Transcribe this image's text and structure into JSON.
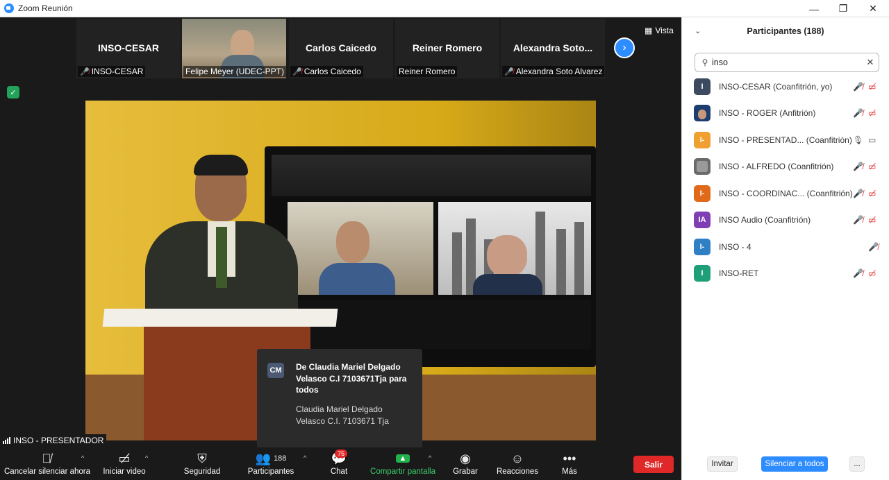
{
  "window": {
    "title": "Zoom Reunión",
    "controls": [
      "—",
      "❐",
      "✕"
    ]
  },
  "strip": {
    "tiles": [
      {
        "name": "INSO-CESAR",
        "label": "INSO-CESAR",
        "muted": true
      },
      {
        "name": "",
        "label": "Felipe Meyer (UDEC-PPT)",
        "muted": false,
        "photo": true
      },
      {
        "name": "Carlos Caicedo",
        "label": "Carlos Caicedo",
        "muted": true
      },
      {
        "name": "Reiner Romero",
        "label": "Reiner Romero",
        "muted": false
      },
      {
        "name": "Alexandra  Soto...",
        "label": "Alexandra Soto Alvarez",
        "muted": true
      }
    ],
    "view_label": "Vista"
  },
  "toast": {
    "avatar": "CM",
    "from": "De Claudia Mariel Delgado Velasco C.I 7103671Tja para todos",
    "message": "Claudia Mariel Delgado Velasco C.I. 7103671 Tja"
  },
  "presenter_label": "INSO - PRESENTADOR",
  "toolbar": {
    "mute": "Cancelar silenciar ahora",
    "video": "Iniciar video",
    "security": "Seguridad",
    "participants": "Participantes",
    "participants_count": "188",
    "chat": "Chat",
    "chat_badge": "75",
    "share": "Compartir pantalla",
    "record": "Grabar",
    "reactions": "Reacciones",
    "more": "Más",
    "leave": "Salir"
  },
  "panel": {
    "title": "Participantes (188)",
    "search_value": "inso",
    "participants": [
      {
        "name": "INSO-CESAR (Coanfitrión, yo)",
        "avatar": "I",
        "color": "#3b4a5e",
        "mic": "muted",
        "cam": "off"
      },
      {
        "name": "INSO - ROGER (Anfitrión)",
        "avatar": "",
        "color": "#1d3d6e",
        "mic": "muted",
        "cam": "off",
        "photo": true
      },
      {
        "name": "INSO - PRESENTAD...   (Coanfitrión)",
        "avatar": "I-",
        "color": "#f0a030",
        "mic": "on",
        "cam": "on"
      },
      {
        "name": "INSO - ALFREDO (Coanfitrión)",
        "avatar": "",
        "color": "#6a6a6a",
        "mic": "muted",
        "cam": "off",
        "photo": true
      },
      {
        "name": "INSO - COORDINAC...  (Coanfitrión)",
        "avatar": "I-",
        "color": "#e06a1a",
        "mic": "muted",
        "cam": "off"
      },
      {
        "name": "INSO Audio (Coanfitrión)",
        "avatar": "IA",
        "color": "#7e3fb5",
        "mic": "muted",
        "cam": "off"
      },
      {
        "name": "INSO - 4",
        "avatar": "I-",
        "color": "#2e7fc4",
        "mic": "muted",
        "cam": "none"
      },
      {
        "name": "INSO-RET",
        "avatar": "I",
        "color": "#1f9e7a",
        "mic": "muted",
        "cam": "off"
      }
    ],
    "invite": "Invitar",
    "mute_all": "Silenciar a todos",
    "more": "..."
  }
}
